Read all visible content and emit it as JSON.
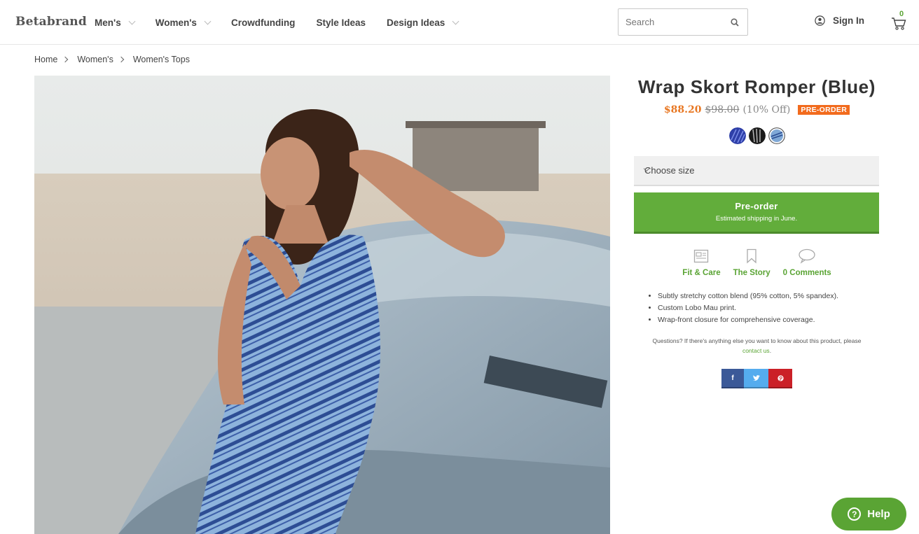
{
  "header": {
    "logo": "Betabrand",
    "nav": [
      {
        "label": "Men's",
        "dropdown": true
      },
      {
        "label": "Women's",
        "dropdown": true
      },
      {
        "label": "Crowdfunding",
        "dropdown": false
      },
      {
        "label": "Style Ideas",
        "dropdown": false
      },
      {
        "label": "Design Ideas",
        "dropdown": true
      }
    ],
    "search_placeholder": "Search",
    "signin_label": "Sign In",
    "cart_count": "0"
  },
  "breadcrumb": [
    "Home",
    "Women's",
    "Women's Tops"
  ],
  "product": {
    "title": "Wrap Skort Romper (Blue)",
    "price_now": "$88.20",
    "price_was": "$98.00",
    "price_off": "(10% Off)",
    "badge": "PRE-ORDER",
    "size_placeholder": "Choose size",
    "cta_label": "Pre-order",
    "cta_sub": "Estimated shipping in June.",
    "tabs": [
      {
        "label": "Fit & Care",
        "icon": "fit-care-icon"
      },
      {
        "label": "The Story",
        "icon": "bookmark-icon"
      },
      {
        "label": "0 Comments",
        "icon": "comment-icon"
      }
    ],
    "bullets": [
      "Subtly stretchy cotton blend (95% cotton, 5% spandex).",
      "Custom Lobo Mau print.",
      "Wrap-front closure for comprehensive coverage."
    ],
    "questions_text": "Questions? If there's anything else you want to know about this product, please",
    "contact_link": "contact us",
    "share": [
      "f",
      "t",
      "p"
    ]
  },
  "help_label": "Help",
  "colors": {
    "accent_green": "#5aa434",
    "price_orange": "#e87722",
    "badge_orange": "#f26b1d"
  }
}
